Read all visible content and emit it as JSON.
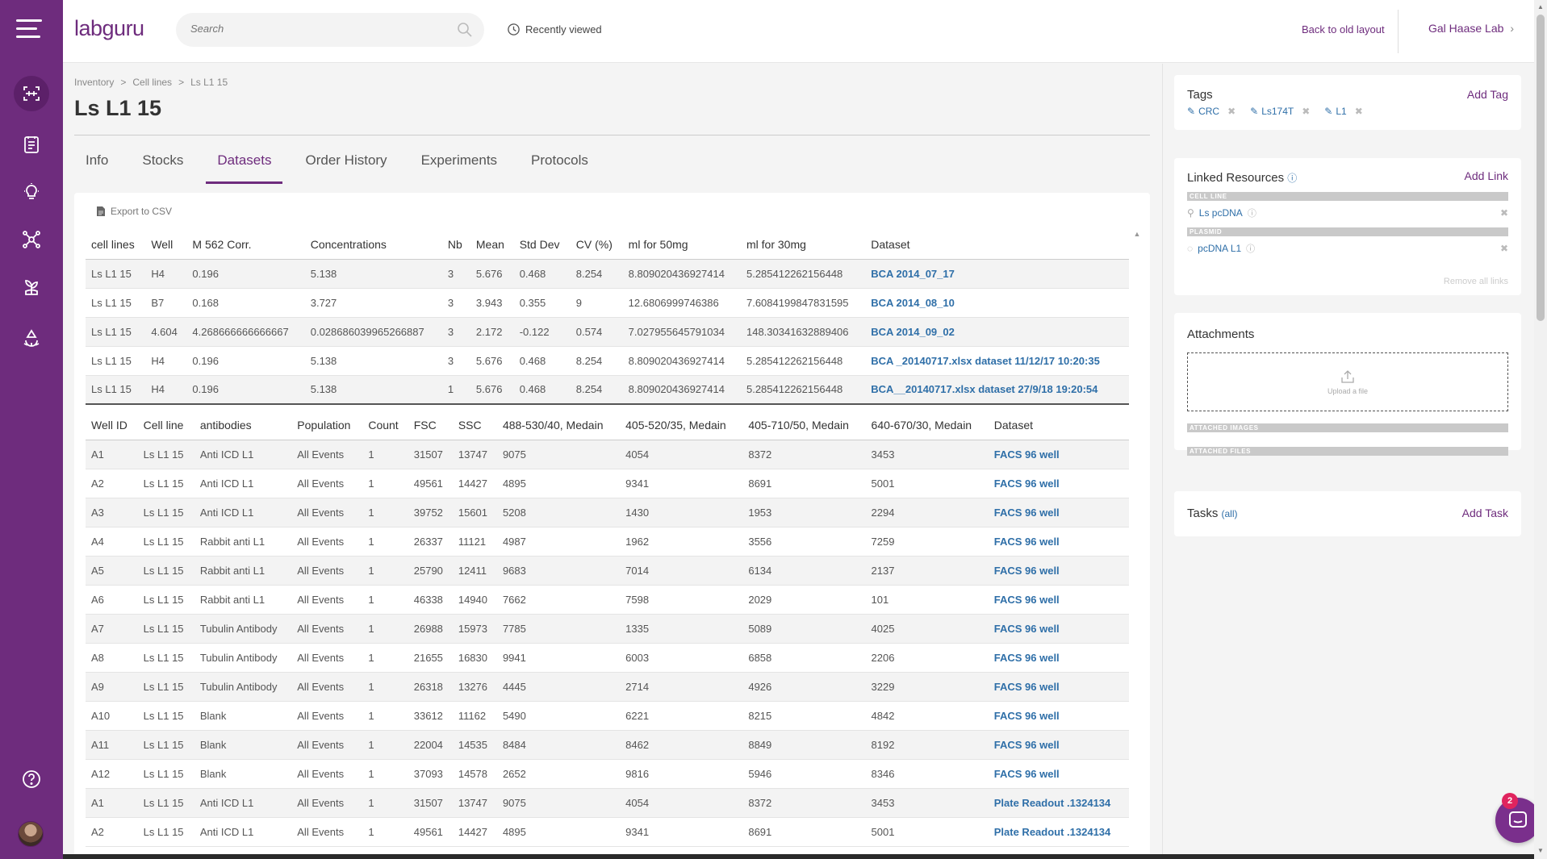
{
  "app": {
    "logo": "labguru"
  },
  "topbar": {
    "search_placeholder": "Search",
    "recently_viewed": "Recently viewed",
    "back_link": "Back to old layout",
    "lab_name": "Gal Haase Lab"
  },
  "rail": {
    "icons": [
      "menu-icon",
      "inventory-icon",
      "notebook-icon",
      "lightbulb-icon",
      "network-icon",
      "plant-icon",
      "recycle-icon",
      "help-icon",
      "avatar"
    ]
  },
  "breadcrumb": {
    "items": [
      "Inventory",
      "Cell lines",
      "Ls L1 15"
    ],
    "separator": ">"
  },
  "page": {
    "title": "Ls L1 15"
  },
  "tabs": [
    "Info",
    "Stocks",
    "Datasets",
    "Order History",
    "Experiments",
    "Protocols"
  ],
  "active_tab": "Datasets",
  "export_label": "Export to CSV",
  "table1": {
    "headers": [
      "cell lines",
      "Well",
      "M 562 Corr.",
      "Concentrations",
      "Nb",
      "Mean",
      "Std Dev",
      "CV (%)",
      "ml for 50mg",
      "ml for 30mg",
      "Dataset"
    ],
    "rows": [
      [
        "Ls L1 15",
        "H4",
        "0.196",
        "5.138",
        "3",
        "5.676",
        "0.468",
        "8.254",
        "8.809020436927414",
        "5.285412262156448",
        "BCA 2014_07_17"
      ],
      [
        "Ls L1 15",
        "B7",
        "0.168",
        "3.727",
        "3",
        "3.943",
        "0.355",
        "9",
        "12.6806999746386",
        "7.6084199847831595",
        "BCA 2014_08_10"
      ],
      [
        "Ls L1 15",
        "4.604",
        "4.268666666666667",
        "0.028686039965266887",
        "3",
        "2.172",
        "-0.122",
        "0.574",
        "7.027955645791034",
        "148.30341632889406",
        "BCA 2014_09_02"
      ],
      [
        "Ls L1 15",
        "H4",
        "0.196",
        "5.138",
        "3",
        "5.676",
        "0.468",
        "8.254",
        "8.809020436927414",
        "5.285412262156448",
        "BCA _20140717.xlsx dataset 11/12/17 10:20:35"
      ],
      [
        "Ls L1 15",
        "H4",
        "0.196",
        "5.138",
        "1",
        "5.676",
        "0.468",
        "8.254",
        "8.809020436927414",
        "5.285412262156448",
        "BCA__20140717.xlsx dataset 27/9/18 19:20:54"
      ]
    ]
  },
  "table2": {
    "headers": [
      "Well ID",
      "Cell line",
      "antibodies",
      "Population",
      "Count",
      "FSC",
      "SSC",
      "488-530/40, Medain",
      "405-520/35, Medain",
      "405-710/50, Medain",
      "640-670/30, Medain",
      "Dataset"
    ],
    "rows": [
      [
        "A1",
        "Ls L1 15",
        "Anti ICD L1",
        "All Events",
        "1",
        "31507",
        "13747",
        "9075",
        "4054",
        "8372",
        "3453",
        "FACS 96 well"
      ],
      [
        "A2",
        "Ls L1 15",
        "Anti ICD L1",
        "All Events",
        "1",
        "49561",
        "14427",
        "4895",
        "9341",
        "8691",
        "5001",
        "FACS 96 well"
      ],
      [
        "A3",
        "Ls L1 15",
        "Anti ICD L1",
        "All Events",
        "1",
        "39752",
        "15601",
        "5208",
        "1430",
        "1953",
        "2294",
        "FACS 96 well"
      ],
      [
        "A4",
        "Ls L1 15",
        "Rabbit anti L1",
        "All Events",
        "1",
        "26337",
        "11121",
        "4987",
        "1962",
        "3556",
        "7259",
        "FACS 96 well"
      ],
      [
        "A5",
        "Ls L1 15",
        "Rabbit anti L1",
        "All Events",
        "1",
        "25790",
        "12411",
        "9683",
        "7014",
        "6134",
        "2137",
        "FACS 96 well"
      ],
      [
        "A6",
        "Ls L1 15",
        "Rabbit anti L1",
        "All Events",
        "1",
        "46338",
        "14940",
        "7662",
        "7598",
        "2029",
        "101",
        "FACS 96 well"
      ],
      [
        "A7",
        "Ls L1 15",
        "Tubulin Antibody",
        "All Events",
        "1",
        "26988",
        "15973",
        "7785",
        "1335",
        "5089",
        "4025",
        "FACS 96 well"
      ],
      [
        "A8",
        "Ls L1 15",
        "Tubulin Antibody",
        "All Events",
        "1",
        "21655",
        "16830",
        "9941",
        "6003",
        "6858",
        "2206",
        "FACS 96 well"
      ],
      [
        "A9",
        "Ls L1 15",
        "Tubulin Antibody",
        "All Events",
        "1",
        "26318",
        "13276",
        "4445",
        "2714",
        "4926",
        "3229",
        "FACS 96 well"
      ],
      [
        "A10",
        "Ls L1 15",
        "Blank",
        "All Events",
        "1",
        "33612",
        "11162",
        "5490",
        "6221",
        "8215",
        "4842",
        "FACS 96 well"
      ],
      [
        "A11",
        "Ls L1 15",
        "Blank",
        "All Events",
        "1",
        "22004",
        "14535",
        "8484",
        "8462",
        "8849",
        "8192",
        "FACS 96 well"
      ],
      [
        "A12",
        "Ls L1 15",
        "Blank",
        "All Events",
        "1",
        "37093",
        "14578",
        "2652",
        "9816",
        "5946",
        "8346",
        "FACS 96 well"
      ],
      [
        "A1",
        "Ls L1 15",
        "Anti ICD L1",
        "All Events",
        "1",
        "31507",
        "13747",
        "9075",
        "4054",
        "8372",
        "3453",
        "Plate Readout .1324134"
      ],
      [
        "A2",
        "Ls L1 15",
        "Anti ICD L1",
        "All Events",
        "1",
        "49561",
        "14427",
        "4895",
        "9341",
        "8691",
        "5001",
        "Plate Readout .1324134"
      ]
    ]
  },
  "sidebar": {
    "tags": {
      "title": "Tags",
      "action": "Add Tag",
      "items": [
        "CRC",
        "Ls174T",
        "L1"
      ]
    },
    "linked": {
      "title": "Linked Resources",
      "action": "Add Link",
      "sections": [
        {
          "label": "CELL LINE",
          "item": "Ls pcDNA"
        },
        {
          "label": "PLASMID",
          "item": "pcDNA L1"
        }
      ],
      "remove_all": "Remove all links"
    },
    "attachments": {
      "title": "Attachments",
      "upload": "Upload a file",
      "images_label": "ATTACHED IMAGES",
      "files_label": "ATTACHED FILES"
    },
    "tasks": {
      "title": "Tasks",
      "all": "(all)",
      "action": "Add Task"
    }
  },
  "chat": {
    "badge": "2"
  },
  "colors": {
    "brand": "#6e2c7d",
    "link": "#2f6fa8",
    "badge": "#e0245e"
  }
}
